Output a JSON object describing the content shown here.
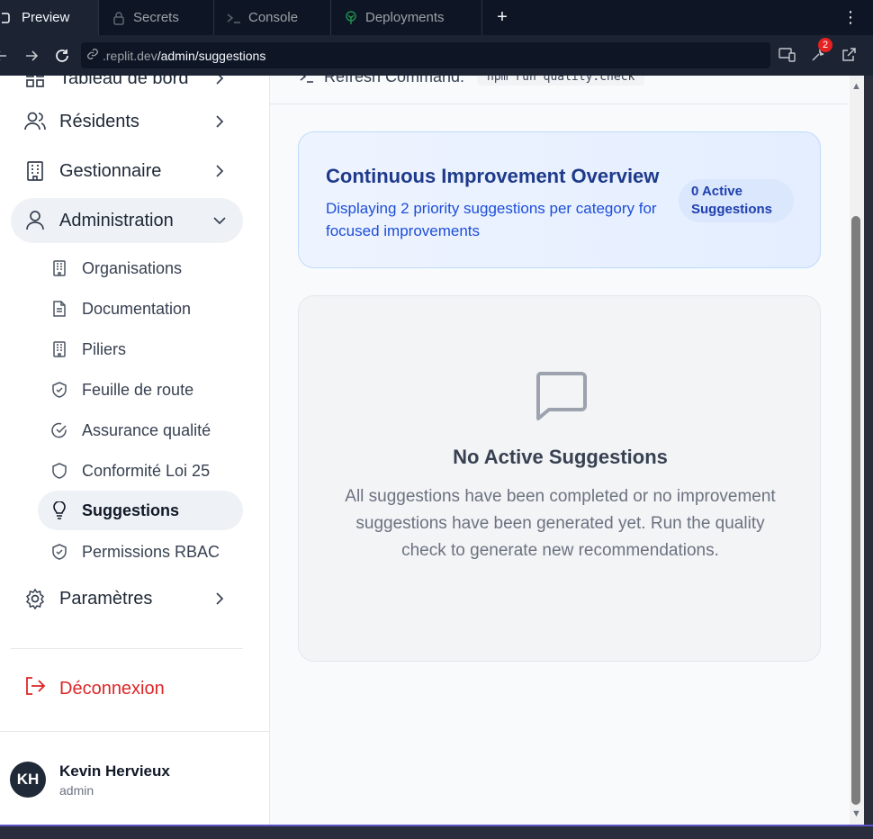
{
  "tabs": [
    {
      "label": "Preview",
      "icon": "monitor-icon"
    },
    {
      "label": "Secrets",
      "icon": "lock-icon"
    },
    {
      "label": "Console",
      "icon": "terminal-icon"
    },
    {
      "label": "Deployments",
      "icon": "tree-icon"
    }
  ],
  "tabbar": {
    "add": "+",
    "more": "⋮"
  },
  "urlbar": {
    "domain": ".replit.dev",
    "path": "/admin/suggestions",
    "notifications": "2"
  },
  "sidebar": {
    "partial_item": "Tableau de bord",
    "items": [
      {
        "label": "Résidents"
      },
      {
        "label": "Gestionnaire"
      },
      {
        "label": "Administration"
      }
    ],
    "sub_items": [
      {
        "label": "Organisations"
      },
      {
        "label": "Documentation"
      },
      {
        "label": "Piliers"
      },
      {
        "label": "Feuille de route"
      },
      {
        "label": "Assurance qualité"
      },
      {
        "label": "Conformité Loi 25"
      },
      {
        "label": "Suggestions"
      },
      {
        "label": "Permissions RBAC"
      }
    ],
    "settings": "Paramètres",
    "logout": "Déconnexion",
    "user": {
      "initials": "KH",
      "name": "Kevin Hervieux",
      "role": "admin"
    }
  },
  "main": {
    "refresh_label": "Refresh Command:",
    "refresh_command": "npm run quality:check",
    "overview": {
      "title": "Continuous Improvement Overview",
      "description": "Displaying 2 priority suggestions per category for focused improvements",
      "active_pill": "0 Active Suggestions"
    },
    "empty": {
      "title": "No Active Suggestions",
      "text": "All suggestions have been completed or no improvement suggestions have been generated yet. Run the quality check to generate new recommendations."
    }
  },
  "colors": {
    "accent": "#1e3a8a",
    "danger": "#dc2626",
    "ide_bg": "#0e1525"
  }
}
